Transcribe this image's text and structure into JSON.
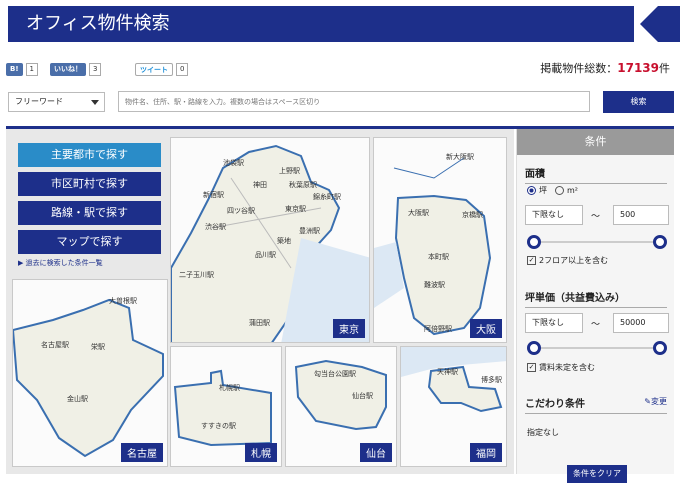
{
  "header": {
    "title": "オフィス物件検索"
  },
  "social": {
    "b_count": "1",
    "like_label": "いいね！",
    "like_count": "3",
    "tweet_label": "ツイート",
    "tweet_count": "0"
  },
  "total": {
    "label": "掲載物件総数：",
    "count": "17139",
    "unit": "件"
  },
  "search": {
    "mode": "フリーワード",
    "placeholder": "物件名、住所、駅・路線を入力。複数の場合はスペース区切り",
    "button": "検索"
  },
  "nav": {
    "items": [
      "主要都市で探す",
      "市区町村で探す",
      "路線・駅で探す",
      "マップで探す"
    ],
    "history": "過去に検索した条件一覧"
  },
  "maps": {
    "tokyo": {
      "label": "東京",
      "stations": [
        "池袋駅",
        "上野駅",
        "秋葉原駅",
        "錦糸町駅",
        "新宿駅",
        "四ツ谷駅",
        "東京駅",
        "渋谷駅",
        "豊洲駅",
        "品川駅",
        "二子玉川駅",
        "蒲田駅",
        "神田",
        "築地"
      ]
    },
    "osaka": {
      "label": "大阪",
      "stations": [
        "新大阪駅",
        "大阪駅",
        "京橋駅",
        "本町駅",
        "難波駅",
        "阿倍野駅"
      ]
    },
    "nagoya": {
      "label": "名古屋",
      "stations": [
        "大曽根駅",
        "名古屋駅",
        "栄駅",
        "金山駅"
      ]
    },
    "sapporo": {
      "label": "札幌",
      "stations": [
        "札幌駅",
        "すすきの駅"
      ]
    },
    "sendai": {
      "label": "仙台",
      "stations": [
        "勾当台公園駅",
        "仙台駅"
      ]
    },
    "fukuoka": {
      "label": "福岡",
      "stations": [
        "天神駅",
        "博多駅"
      ]
    }
  },
  "side": {
    "header": "条件",
    "area": {
      "title": "面積",
      "unit_tsubo": "坪",
      "unit_m2": "m²",
      "min": "下限なし",
      "tilde": "〜",
      "max": "500",
      "check": "2フロア以上を含む",
      "min_pos": 0,
      "max_pos": 1
    },
    "price": {
      "title": "坪単価（共益費込み）",
      "min": "下限なし",
      "tilde": "〜",
      "max": "50000",
      "check": "賃料未定を含む",
      "min_pos": 0,
      "max_pos": 1
    },
    "kodawari": {
      "title": "こだわり条件",
      "change": "変更",
      "none": "指定なし"
    },
    "clear": "条件をクリア"
  },
  "colors": {
    "navy": "#1d2f8a",
    "light_blue": "#2a8cc8",
    "red": "#c8102e"
  }
}
